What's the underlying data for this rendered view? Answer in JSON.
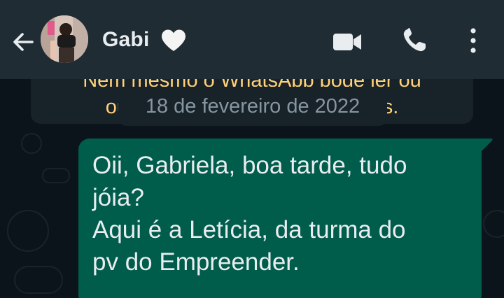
{
  "header": {
    "contact_name": "Gabi",
    "name_emoji": "white-heart-icon",
    "actions": [
      "video-call-icon",
      "voice-call-icon",
      "more-options-icon"
    ]
  },
  "encryption_notice": {
    "line1": "Nem mesmo o WhatsApp pode ler ou",
    "line2": "ouvi-las. Toque para saber mais."
  },
  "date_divider": "18 de fevereiro de 2022",
  "message": {
    "direction": "outgoing",
    "lines": [
      "Oii, Gabriela, boa tarde, tudo",
      "jóia?",
      "Aqui é a Letícia, da turma do",
      "pv do Empreender."
    ]
  },
  "colors": {
    "header_bg": "#1f2c34",
    "chat_bg": "#0b141a",
    "outgoing_bubble": "#005c4b",
    "notice_text": "#ffd279",
    "date_text": "#8696a0",
    "text": "#e9edef"
  }
}
